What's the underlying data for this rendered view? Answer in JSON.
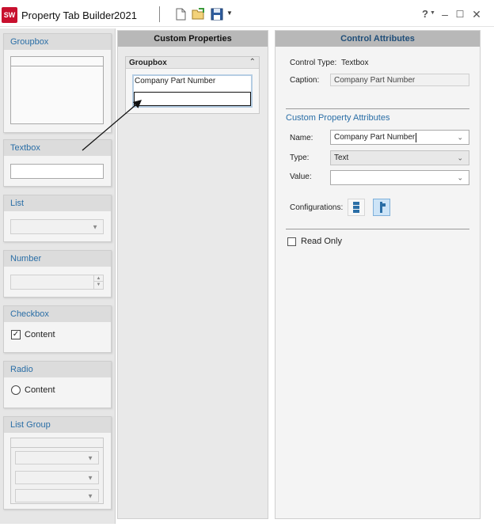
{
  "window": {
    "icon_text": "SW",
    "title": "Property Tab Builder",
    "version": "2021",
    "help_label": "?",
    "controls": {
      "minimize": "–",
      "maximize": "☐",
      "close": "✕"
    }
  },
  "toolbox": {
    "groupbox_title": "Groupbox",
    "textbox_title": "Textbox",
    "list_title": "List",
    "number_title": "Number",
    "checkbox_title": "Checkbox",
    "checkbox_content": "Content",
    "radio_title": "Radio",
    "radio_content": "Content",
    "listgroup_title": "List Group"
  },
  "custom_properties": {
    "header": "Custom Properties",
    "groupbox_title": "Groupbox",
    "caption": "Company Part Number"
  },
  "control_attributes": {
    "header": "Control Attributes",
    "control_type_label": "Control Type:",
    "control_type_value": "Textbox",
    "caption_label": "Caption:",
    "caption_value": "Company Part Number",
    "section_title": "Custom Property Attributes",
    "name_label": "Name:",
    "name_value": "Company Part Number",
    "type_label": "Type:",
    "type_value": "Text",
    "value_label": "Value:",
    "value_value": "",
    "configurations_label": "Configurations:",
    "read_only_label": "Read Only"
  },
  "colors": {
    "accent": "#2a6ea6",
    "header_gray": "#b8b8b8",
    "app_icon": "#c8102e"
  }
}
